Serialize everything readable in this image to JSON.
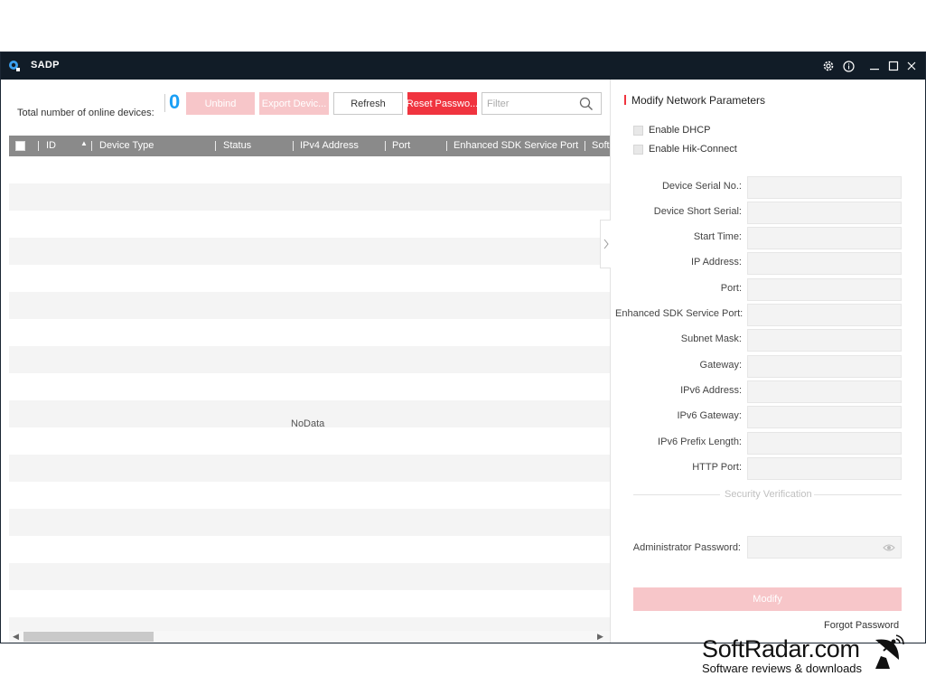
{
  "app": {
    "title": "SADP"
  },
  "toolbar": {
    "total_label": "Total number of online devices:",
    "count": "0",
    "unbind": "Unbind",
    "export": "Export Devic...",
    "refresh": "Refresh",
    "reset_password": "Reset Passwo...",
    "filter_placeholder": "Filter"
  },
  "table": {
    "columns": [
      "ID",
      "Device Type",
      "Status",
      "IPv4 Address",
      "Port",
      "Enhanced SDK Service Port",
      "Soft"
    ],
    "empty_text": "NoData"
  },
  "panel": {
    "title": "Modify Network Parameters",
    "enable_dhcp": "Enable DHCP",
    "enable_hik_connect": "Enable Hik-Connect",
    "fields": [
      "Device Serial No.:",
      "Device Short Serial:",
      "Start Time:",
      "IP Address:",
      "Port:",
      "Enhanced SDK Service Port:",
      "Subnet Mask:",
      "Gateway:",
      "IPv6 Address:",
      "IPv6 Gateway:",
      "IPv6 Prefix Length:",
      "HTTP Port:"
    ],
    "security_verification": "Security Verification",
    "admin_password_label": "Administrator Password:",
    "modify": "Modify",
    "forgot_password": "Forgot Password"
  },
  "colors": {
    "accent_red": "#f0343f",
    "disabled_red": "#f7c6c9",
    "count_blue": "#1a9ff5",
    "titlebar": "#111c27"
  },
  "watermark": {
    "title": "SoftRadar.com",
    "subtitle": "Software reviews & downloads"
  }
}
